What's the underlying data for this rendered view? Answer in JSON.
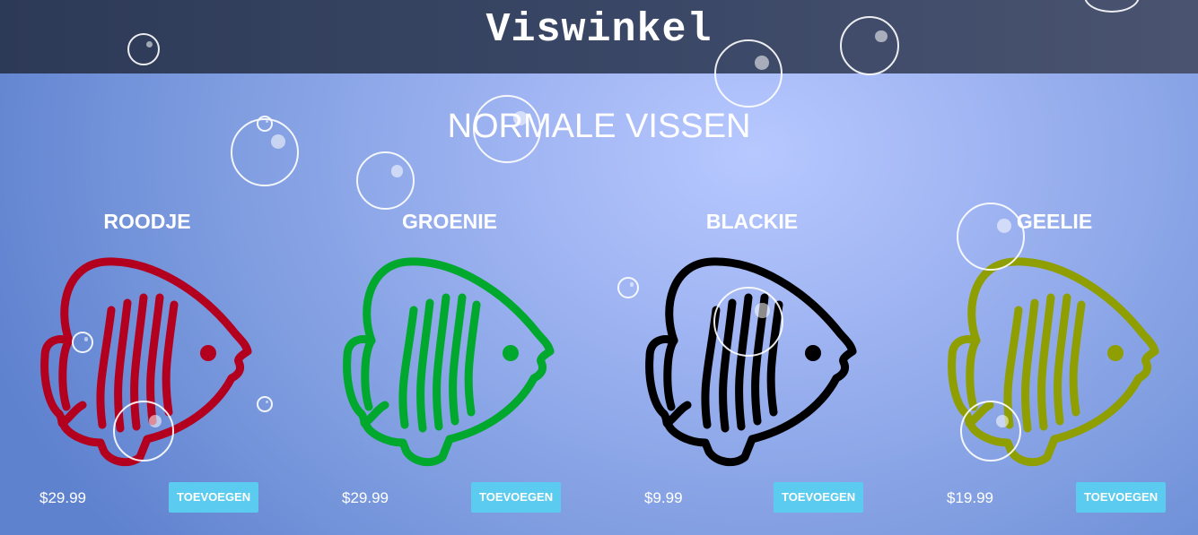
{
  "header": {
    "title": "Viswinkel"
  },
  "section": {
    "title": "NORMALE VISSEN"
  },
  "products": [
    {
      "name": "ROODJE",
      "price": "$29.99",
      "button_label": "TOEVOEGEN",
      "color": "#b3001f"
    },
    {
      "name": "GROENIE",
      "price": "$29.99",
      "button_label": "TOEVOEGEN",
      "color": "#00a82d"
    },
    {
      "name": "BLACKIE",
      "price": "$9.99",
      "button_label": "TOEVOEGEN",
      "color": "#000000"
    },
    {
      "name": "GEELIE",
      "price": "$19.99",
      "button_label": "TOEVOEGEN",
      "color": "#8f9e00"
    }
  ],
  "colors": {
    "header_bg": "#33405e",
    "button_bg": "#5bcbef",
    "bubble": "#ffffff"
  },
  "icons": {
    "product_image": "fish-icon",
    "decoration": "bubble"
  }
}
